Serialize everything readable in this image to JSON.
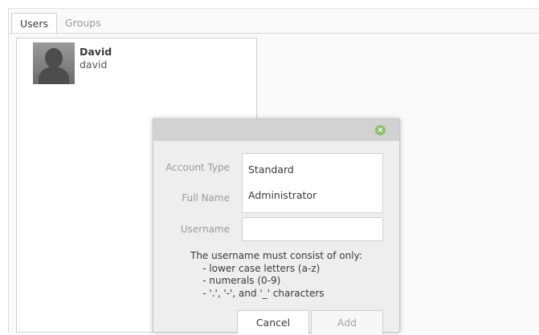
{
  "tabs": [
    {
      "label": "Users"
    },
    {
      "label": "Groups"
    }
  ],
  "users": [
    {
      "display_name": "David",
      "username": "david"
    }
  ],
  "dialog": {
    "close_glyph": "×",
    "account_type_label": "Account Type",
    "full_name_label": "Full Name",
    "username_label": "Username",
    "account_type_options": [
      "Standard",
      "Administrator"
    ],
    "username_value": "",
    "help_lines": [
      "The username must consist of only:",
      "    - lower case letters (a-z)",
      "    - numerals (0-9)",
      "    - '.', '-', and '_' characters"
    ],
    "cancel_label": "Cancel",
    "add_label": "Add"
  }
}
